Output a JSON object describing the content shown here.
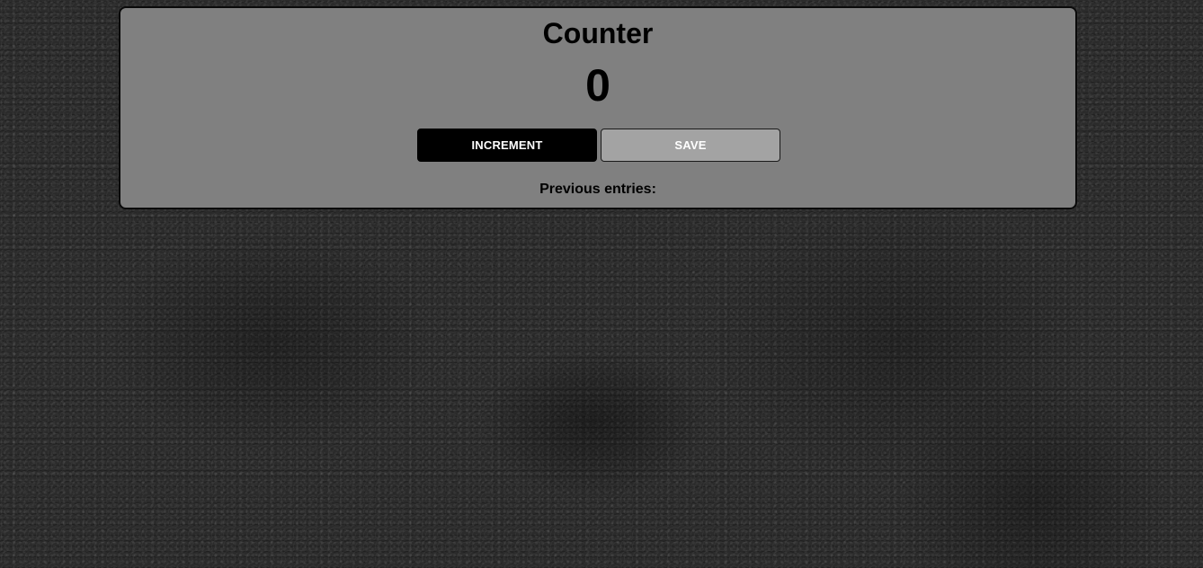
{
  "counter": {
    "title": "Counter",
    "value": "0",
    "increment_label": "INCREMENT",
    "save_label": "SAVE",
    "previous_entries_label": "Previous entries:",
    "previous_entries": []
  },
  "colors": {
    "card_background": "#808080",
    "increment_button": "#000000",
    "save_button": "#a3a3a3",
    "page_background": "#2b2b2b"
  }
}
